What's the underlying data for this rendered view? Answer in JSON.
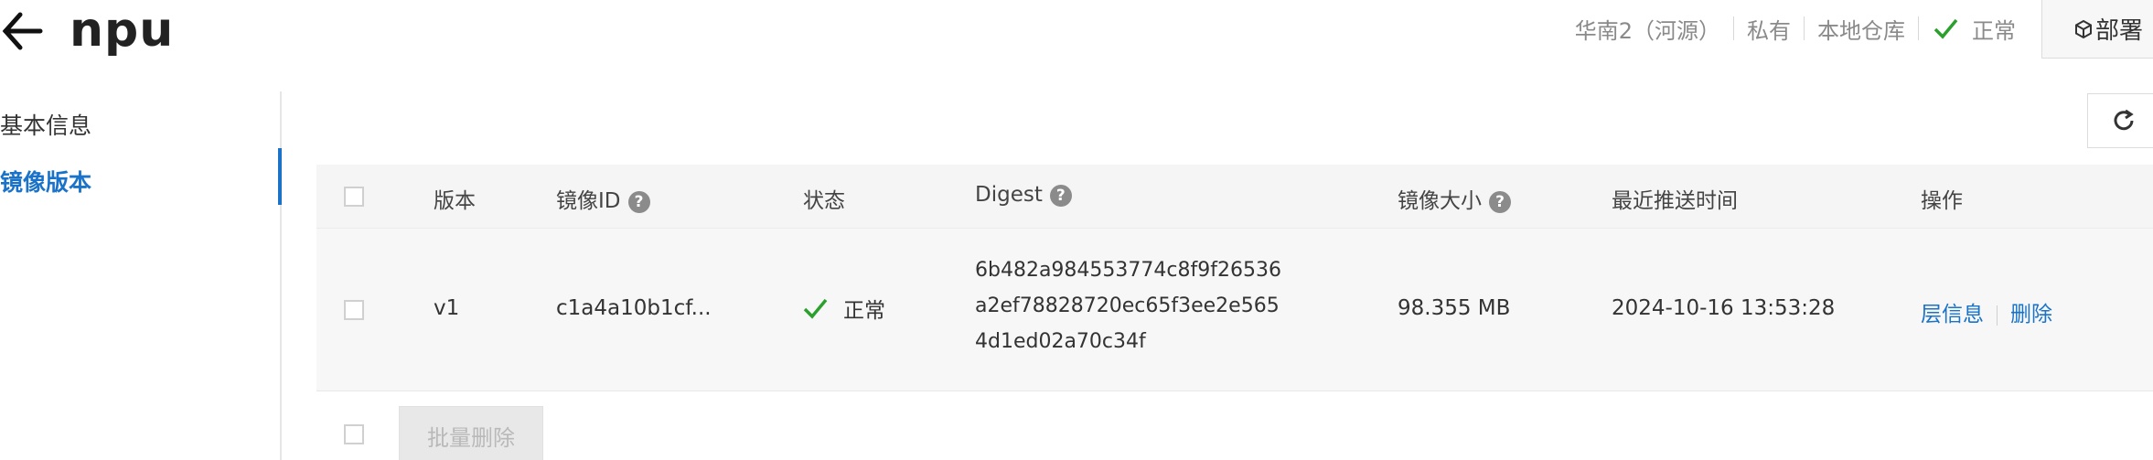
{
  "header": {
    "back_icon": "arrow-left-icon",
    "title": "npu",
    "region": "华南2（河源）",
    "visibility": "私有",
    "repo_type": "本地仓库",
    "status": "正常",
    "status_icon": "check-icon",
    "deploy_label": "部署",
    "deploy_icon": "cube-icon"
  },
  "sidebar": {
    "items": [
      {
        "label": "基本信息",
        "active": false
      },
      {
        "label": "镜像版本",
        "active": true
      }
    ]
  },
  "toolbar": {
    "refresh_icon": "refresh-icon"
  },
  "table": {
    "columns": {
      "version": "版本",
      "image_id": "镜像ID",
      "status": "状态",
      "digest": "Digest",
      "size": "镜像大小",
      "last_push": "最近推送时间",
      "actions": "操作"
    },
    "rows": [
      {
        "version": "v1",
        "image_id": "c1a4a10b1cf...",
        "status": "正常",
        "digest_lines": [
          "6b482a984553774c8f9f26536",
          "a2ef78828720ec65f3ee2e565",
          "4d1ed02a70c34f"
        ],
        "size": "98.355 MB",
        "last_push": "2024-10-16 13:53:28",
        "action_layers": "层信息",
        "action_delete": "删除"
      }
    ]
  },
  "footer": {
    "batch_delete": "批量删除"
  },
  "colors": {
    "accent": "#1a73c8",
    "success": "#2ca02c",
    "muted": "#8a8a8a"
  }
}
